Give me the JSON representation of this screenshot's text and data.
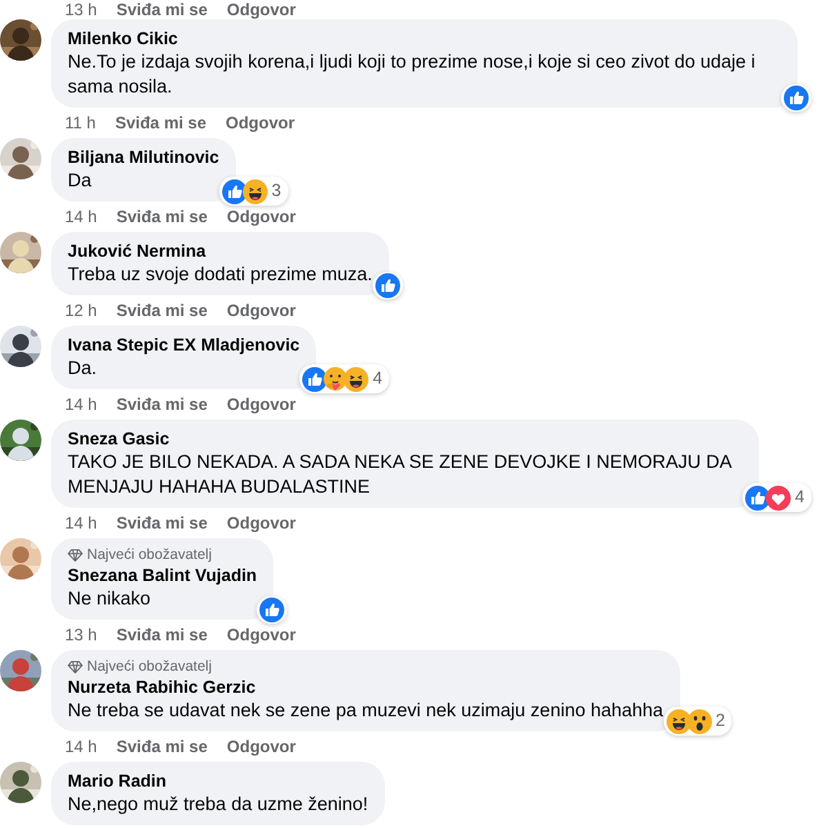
{
  "top_actions": {
    "time": "13 h",
    "like": "Sviđa mi se",
    "reply": "Odgovor"
  },
  "comments": [
    {
      "name": "Milenko Cikic",
      "text": "Ne.To je izdaja svojih korena,i ljudi koji to prezime nose,i koje si ceo zivot do udaje i sama nosila.",
      "reactions": [
        {
          "kind": "like"
        }
      ],
      "actions": {
        "time": "11 h",
        "like": "Sviđa mi se",
        "reply": "Odgovor"
      }
    },
    {
      "name": "Biljana Milutinovic",
      "text": "Da",
      "reactions": [
        {
          "kind": "like"
        },
        {
          "kind": "haha"
        }
      ],
      "count": "3",
      "actions": {
        "time": "14 h",
        "like": "Sviđa mi se",
        "reply": "Odgovor"
      }
    },
    {
      "name": "Juković Nermina",
      "text": "Treba uz svoje dodati prezime muza.",
      "reactions": [
        {
          "kind": "like"
        }
      ],
      "actions": {
        "time": "12 h",
        "like": "Sviđa mi se",
        "reply": "Odgovor"
      }
    },
    {
      "name": "Ivana Stepic EX Mladjenovic",
      "text": "Da.",
      "reactions": [
        {
          "kind": "like"
        },
        {
          "kind": "care"
        },
        {
          "kind": "haha"
        }
      ],
      "count": "4",
      "actions": {
        "time": "14 h",
        "like": "Sviđa mi se",
        "reply": "Odgovor"
      }
    },
    {
      "name": "Sneza Gasic",
      "text": "TAKO JE BILO NEKADA. A SADA NEKA SE ZENE DEVOJKE I NEMORAJU DA MENJAJU HAHAHA BUDALASTINE",
      "reactions": [
        {
          "kind": "like"
        },
        {
          "kind": "love"
        }
      ],
      "count": "4",
      "actions": {
        "time": "14 h",
        "like": "Sviđa mi se",
        "reply": "Odgovor"
      }
    },
    {
      "badge": "Najveći obožavatelj",
      "name": "Snezana Balint Vujadin",
      "text": "Ne nikako",
      "reactions": [
        {
          "kind": "like"
        }
      ],
      "actions": {
        "time": "13 h",
        "like": "Sviđa mi se",
        "reply": "Odgovor"
      }
    },
    {
      "badge": "Najveći obožavatelj",
      "name": "Nurzeta Rabihic Gerzic",
      "text": "Ne treba se udavat nek se zene pa muzevi nek uzimaju zenino hahahha",
      "reactions": [
        {
          "kind": "haha"
        },
        {
          "kind": "wow"
        }
      ],
      "count": "2",
      "actions": {
        "time": "14 h",
        "like": "Sviđa mi se",
        "reply": "Odgovor"
      }
    },
    {
      "name": "Mario Radin",
      "text": "Ne,nego muž treba da uzme ženino!"
    }
  ]
}
